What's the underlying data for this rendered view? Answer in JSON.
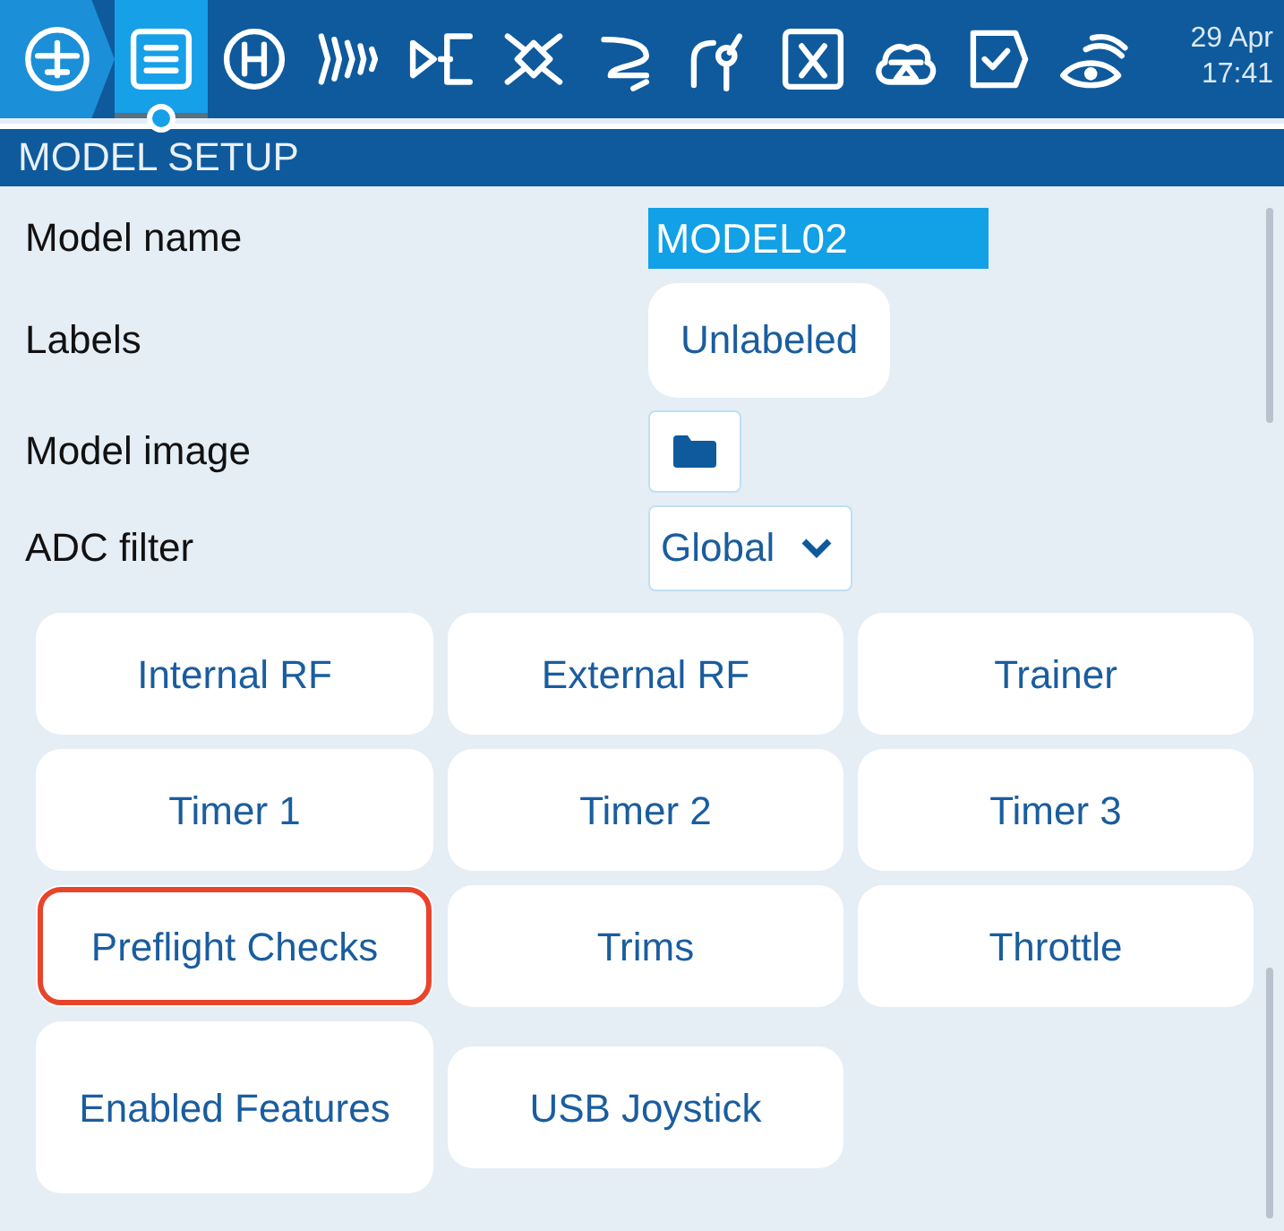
{
  "toolbar_tabs": [
    {
      "selected": false
    },
    {
      "selected": true
    },
    {
      "selected": false
    },
    {
      "selected": false
    },
    {
      "selected": false
    },
    {
      "selected": false
    },
    {
      "selected": false
    },
    {
      "selected": false
    },
    {
      "selected": false
    },
    {
      "selected": false
    },
    {
      "selected": false
    },
    {
      "selected": false
    }
  ],
  "clock": {
    "date": "29 Apr",
    "time": "17:41"
  },
  "page_title": "MODEL SETUP",
  "settings": [
    {
      "kind": "text",
      "label": "Model name",
      "value": "MODEL02"
    },
    {
      "kind": "button",
      "label": "Labels",
      "value": "Unlabeled"
    },
    {
      "kind": "file",
      "label": "Model image"
    },
    {
      "kind": "select",
      "label": "ADC filter",
      "value": "Global"
    }
  ],
  "buttons": [
    {
      "label": "Internal RF",
      "highlighted": false
    },
    {
      "label": "External RF",
      "highlighted": false
    },
    {
      "label": "Trainer",
      "highlighted": false
    },
    {
      "label": "Timer 1",
      "highlighted": false
    },
    {
      "label": "Timer 2",
      "highlighted": false
    },
    {
      "label": "Timer 3",
      "highlighted": false
    },
    {
      "label": "Preflight Checks",
      "highlighted": true
    },
    {
      "label": "Trims",
      "highlighted": false
    },
    {
      "label": "Throttle",
      "highlighted": false
    },
    {
      "label": "Enabled Features",
      "highlighted": false
    },
    {
      "label": "USB Joystick",
      "highlighted": false
    }
  ]
}
